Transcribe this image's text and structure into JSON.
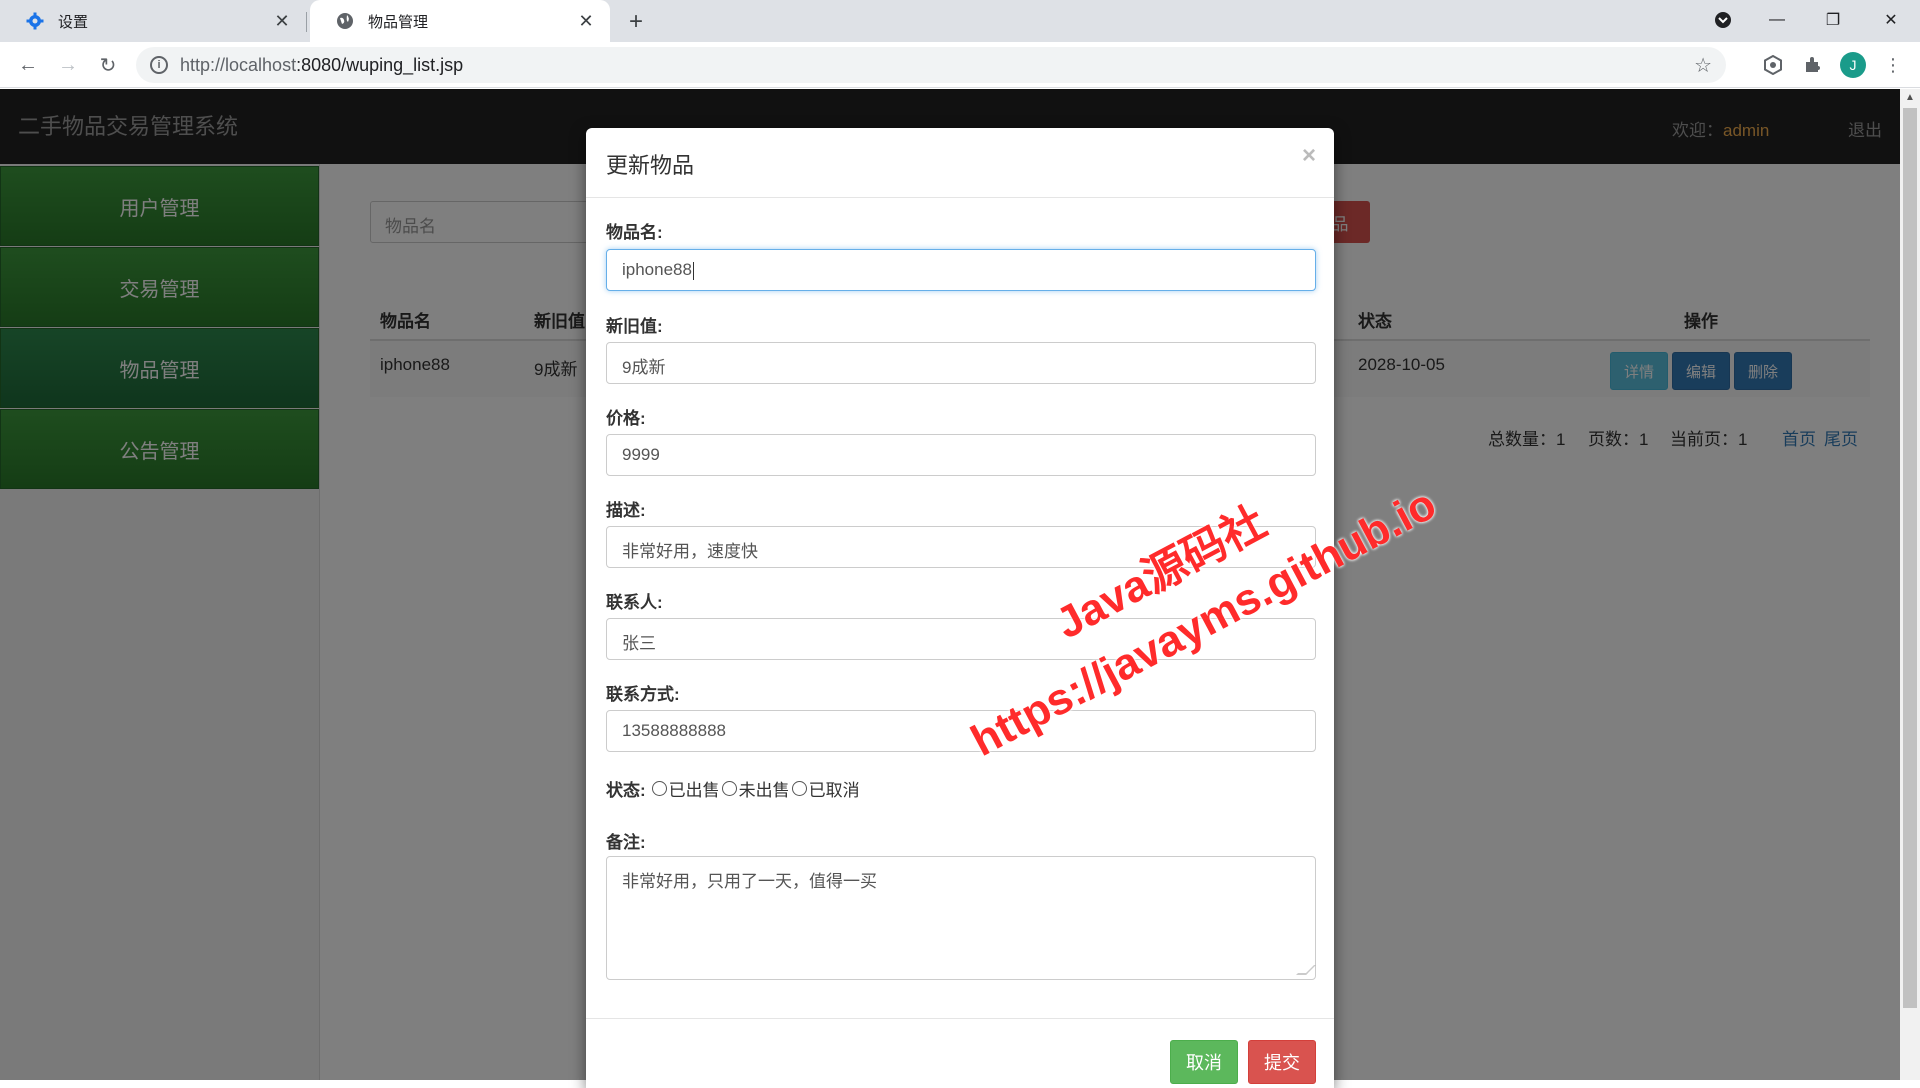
{
  "browser": {
    "tabs": [
      {
        "title": "设置",
        "icon": "gear-icon"
      },
      {
        "title": "物品管理",
        "icon": "globe-icon"
      }
    ],
    "url_host": "http://localhost",
    "url_rest": ":8080/wuping_list.jsp",
    "avatar_letter": "J"
  },
  "app": {
    "brand": "二手物品交易管理系统",
    "welcome_label": "欢迎：",
    "username": "admin",
    "logout": "退出"
  },
  "sidebar": {
    "items": [
      {
        "label": "用户管理"
      },
      {
        "label": "交易管理"
      },
      {
        "label": "物品管理"
      },
      {
        "label": "公告管理"
      }
    ]
  },
  "search": {
    "placeholder": "物品名",
    "add_label_visible": "品"
  },
  "table": {
    "headers": {
      "name": "物品名",
      "condition": "新旧值",
      "status": "状态",
      "actions": "操作"
    },
    "rows": [
      {
        "name": "iphone88",
        "condition": "9成新",
        "date": "2028-10-05"
      }
    ],
    "actions": {
      "detail": "详情",
      "edit": "编辑",
      "delete": "删除"
    }
  },
  "pager": {
    "total": "总数量：1",
    "pages": "页数：1",
    "current": "当前页：1",
    "first": "首页",
    "last": "尾页"
  },
  "modal": {
    "title": "更新物品",
    "close": "×",
    "fields": {
      "name": {
        "label": "物品名:",
        "value": "iphone88"
      },
      "condition": {
        "label": "新旧值:",
        "value": "9成新"
      },
      "price": {
        "label": "价格:",
        "value": "9999"
      },
      "desc": {
        "label": "描述:",
        "value": "非常好用，速度快"
      },
      "contact": {
        "label": "联系人:",
        "value": "张三"
      },
      "phone": {
        "label": "联系方式:",
        "value": "13588888888"
      },
      "remark": {
        "label": "备注:",
        "value": "非常好用，只用了一天，值得一买"
      }
    },
    "status": {
      "label": "状态:",
      "options": [
        "已出售",
        "未出售",
        "已取消"
      ]
    },
    "cancel": "取消",
    "submit": "提交"
  },
  "watermark": {
    "line1": "Java源码社",
    "line2": "https://javayms.github.io"
  },
  "colors": {
    "topbar": "#222222",
    "sidebar_green": "#3d9a3d",
    "danger": "#d9534f",
    "success": "#5cb85c",
    "info": "#5bc0de",
    "primary": "#337ab7",
    "username": "#f0ad4e",
    "watermark": "#ff2b2b"
  }
}
